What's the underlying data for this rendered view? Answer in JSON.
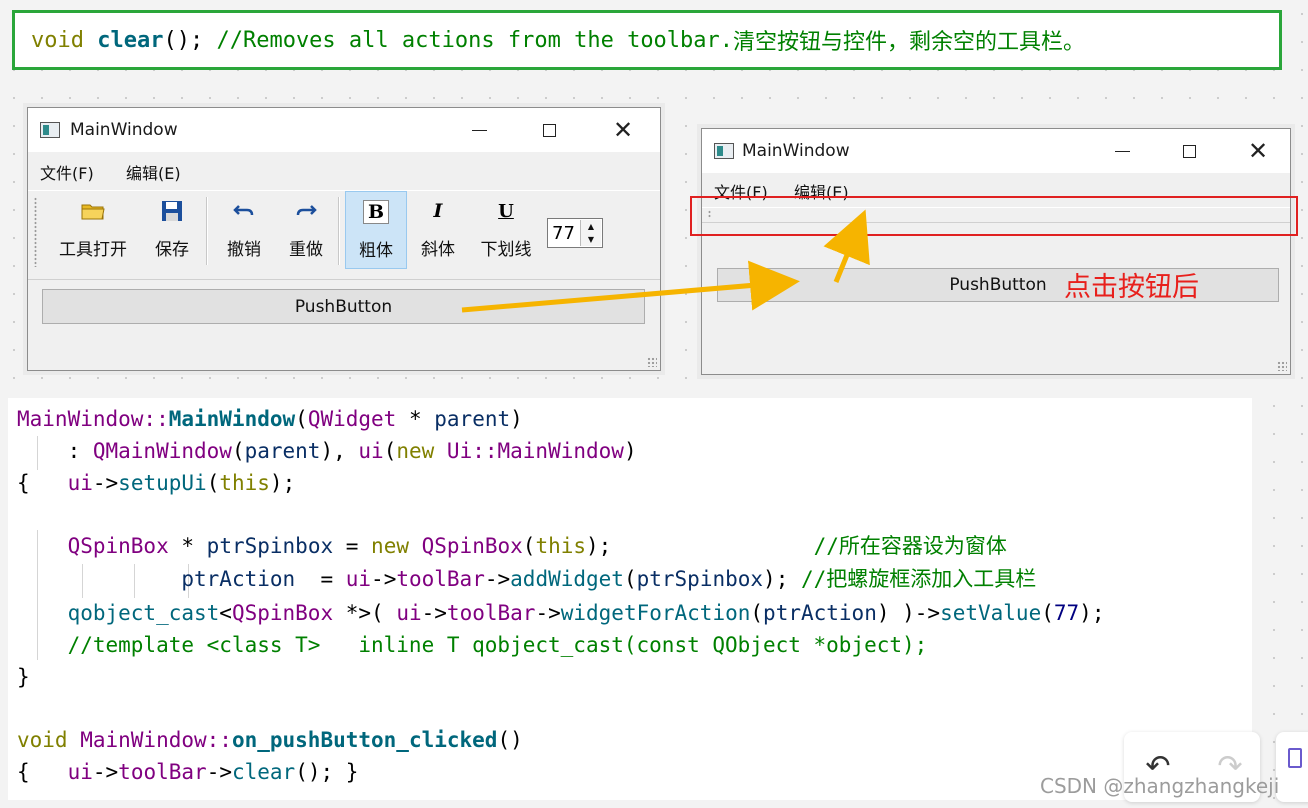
{
  "banner": {
    "kw": "void",
    "fn": "clear",
    "punc": "();",
    "comment": "//Removes all actions from the toolbar.",
    "note": "清空按钮与控件，剩余空的工具栏。"
  },
  "win_left": {
    "title": "MainWindow",
    "menu": [
      "文件(F)",
      "编辑(E)"
    ],
    "toolbar": {
      "open": "工具打开",
      "save": "保存",
      "undo": "撤销",
      "redo": "重做",
      "bold": "粗体",
      "italic": "斜体",
      "underline": "下划线",
      "bold_glyph": "B",
      "italic_glyph": "I",
      "underline_glyph": "U",
      "spin_value": "77"
    },
    "pushbutton": "PushButton"
  },
  "win_right": {
    "title": "MainWindow",
    "menu": [
      "文件(F)",
      "编辑(E)"
    ],
    "pushbutton": "PushButton",
    "annotation": "点击按钮后"
  },
  "code": {
    "l1": {
      "a": "MainWindow::",
      "b": "MainWindow",
      "c": "(",
      "d": "QWidget",
      "e": " * ",
      "f": "parent",
      "g": ")"
    },
    "l2": {
      "a": "    : ",
      "b": "QMainWindow",
      "c": "(",
      "d": "parent",
      "e": "), ",
      "f": "ui",
      "g": "(",
      "h": "new ",
      "i": "Ui::MainWindow",
      "j": ")"
    },
    "l3": {
      "a": "{   ",
      "b": "ui",
      "c": "->",
      "d": "setupUi",
      "e": "(",
      "f": "this",
      "g": ");"
    },
    "l4": {
      "a": "    ",
      "b": "QSpinBox",
      "c": " * ",
      "d": "ptrSpinbox",
      "e": " = ",
      "f": "new ",
      "g": "QSpinBox",
      "h": "(",
      "i": "this",
      "j": ");",
      "k": "                //所在容器设为窗体"
    },
    "l5": {
      "a": "             ",
      "b": "ptrAction",
      "c": "  = ",
      "d": "ui",
      "e": "->",
      "f": "toolBar",
      "g": "->",
      "h": "addWidget",
      "i": "(",
      "j": "ptrSpinbox",
      "k": "); ",
      "l": "//把螺旋框添加入工具栏"
    },
    "l6": {
      "a": "    ",
      "b": "qobject_cast",
      "c": "<",
      "d": "QSpinBox",
      "e": " *>( ",
      "f": "ui",
      "g": "->",
      "h": "toolBar",
      "i": "->",
      "j": "widgetForAction",
      "k": "(",
      "l": "ptrAction",
      "m": ") )->",
      "n": "setValue",
      "o": "(",
      "p": "77",
      "q": ");"
    },
    "l7": {
      "a": "    //template <class T>   inline T qobject_cast(const QObject *object);"
    },
    "l8": {
      "a": "}"
    },
    "l9": {
      "a": "void ",
      "b": "MainWindow::",
      "c": "on_pushButton_clicked",
      "d": "()"
    },
    "l10": {
      "a": "{   ",
      "b": "ui",
      "c": "->",
      "d": "toolBar",
      "e": "->",
      "f": "clear",
      "g": "(); }"
    }
  },
  "watermark": "CSDN @zhangzhangkeji",
  "icons": {
    "undo": "undo-icon",
    "redo": "redo-icon"
  }
}
